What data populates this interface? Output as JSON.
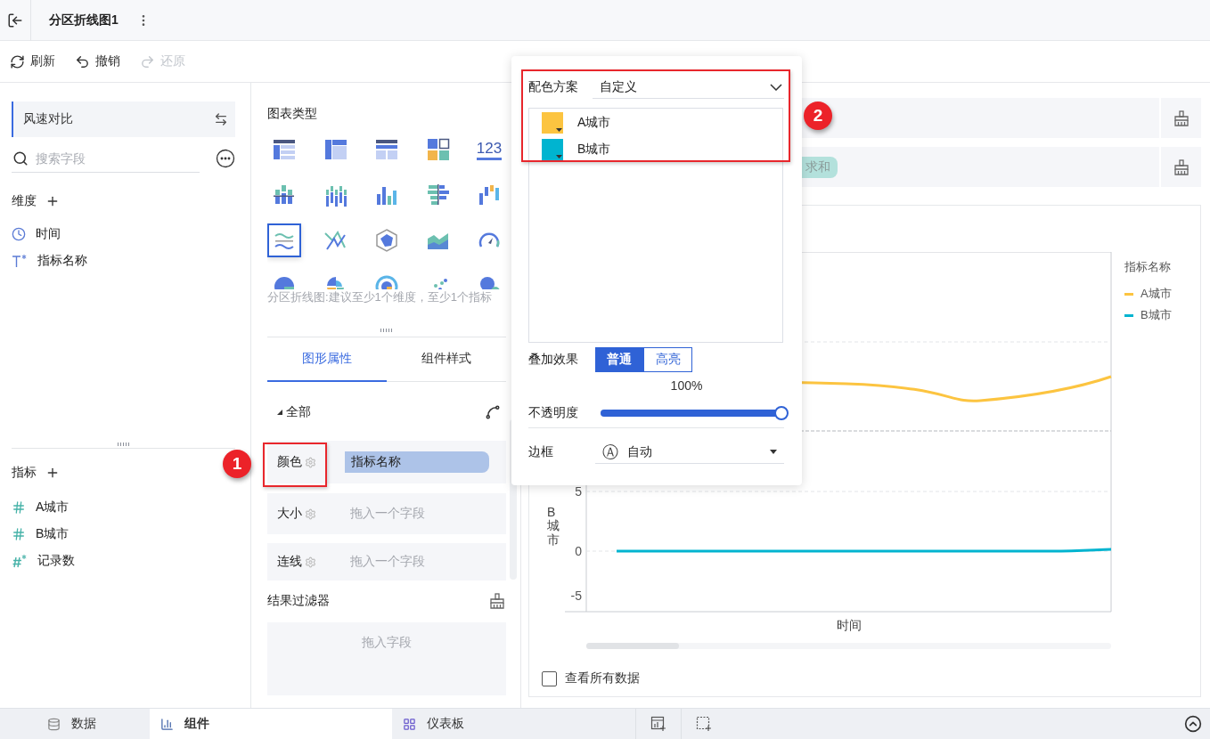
{
  "header": {
    "title": "分区折线图1"
  },
  "toolbar": [
    {
      "label": "刷新",
      "kind": "refresh",
      "disabled": false
    },
    {
      "label": "撤销",
      "kind": "undo",
      "disabled": false
    },
    {
      "label": "还原",
      "kind": "redo",
      "disabled": true
    }
  ],
  "data_panel": {
    "dataset": "风速对比",
    "search": {
      "placeholder": "搜索字段"
    },
    "dimensions": {
      "title": "维度",
      "fields": [
        {
          "name": "时间",
          "kind": "date"
        },
        {
          "name": "指标名称",
          "kind": "text"
        }
      ]
    },
    "measures": {
      "title": "指标",
      "fields": [
        {
          "name": "A城市",
          "kind": "number"
        },
        {
          "name": "B城市",
          "kind": "number"
        },
        {
          "name": "记录数",
          "kind": "count"
        }
      ]
    }
  },
  "chart_types": {
    "title": "图表类型",
    "items": [
      {
        "kind": "table",
        "selected": false
      },
      {
        "kind": "pivot-table",
        "selected": false
      },
      {
        "kind": "group-table",
        "selected": false
      },
      {
        "kind": "tiles",
        "selected": false
      },
      {
        "kind": "number",
        "label": "123",
        "selected": false
      },
      {
        "kind": "stacked-bar",
        "selected": false
      },
      {
        "kind": "grouped-bar",
        "selected": false
      },
      {
        "kind": "bar",
        "selected": false
      },
      {
        "kind": "horizontal-bar",
        "selected": false
      },
      {
        "kind": "waterfall",
        "selected": false
      },
      {
        "kind": "partition-line",
        "selected": true
      },
      {
        "kind": "cross-line",
        "selected": false
      },
      {
        "kind": "radar",
        "selected": false
      },
      {
        "kind": "area",
        "selected": false
      },
      {
        "kind": "gauge",
        "selected": false
      },
      {
        "kind": "pie",
        "selected": false
      },
      {
        "kind": "rose",
        "selected": false
      },
      {
        "kind": "sunburst",
        "selected": false
      },
      {
        "kind": "scatter",
        "selected": false
      },
      {
        "kind": "bubble",
        "selected": false
      }
    ],
    "hint": "分区折线图:建议至少1个维度，至少1个指标"
  },
  "property_tabs": [
    {
      "label": "图形属性",
      "selected": true
    },
    {
      "label": "组件样式",
      "selected": false
    }
  ],
  "properties": {
    "group": "全部",
    "rows": [
      {
        "label": "颜色",
        "value": "指标名称"
      },
      {
        "label": "大小",
        "placeholder": "拖入一个字段"
      },
      {
        "label": "连线",
        "placeholder": "拖入一个字段"
      }
    ]
  },
  "result_filter": {
    "title": "结果过滤器",
    "placeholder": "拖入字段"
  },
  "value_shelf": {
    "chip": "求和"
  },
  "chart": {
    "y_label": "B城市",
    "y_ticks": [
      "5",
      "0",
      "-5"
    ],
    "x_label": "时间",
    "legend": {
      "title": "指标名称",
      "items": [
        {
          "name": "A城市",
          "color": "#fcc440"
        },
        {
          "name": "B城市",
          "color": "#00b4d0"
        }
      ]
    },
    "view_all": {
      "label": "查看所有数据",
      "checked": false
    }
  },
  "color_popover": {
    "label": "配色方案",
    "scheme": "自定义",
    "items": [
      {
        "name": "A城市",
        "color": "#fcc440"
      },
      {
        "name": "B城市",
        "color": "#00b4d0"
      }
    ],
    "blend": {
      "label": "叠加效果",
      "options": [
        {
          "label": "普通",
          "selected": true
        },
        {
          "label": "高亮",
          "selected": false
        }
      ]
    },
    "opacity": {
      "label": "不透明度",
      "reading": "100%",
      "level": 1
    },
    "border": {
      "label": "边框",
      "icon": "Ⓐ",
      "value": "自动"
    }
  },
  "annotations": [
    {
      "label": "1"
    },
    {
      "label": "2"
    }
  ],
  "bottom_tabs": [
    {
      "label": "数据",
      "kind": "data",
      "selected": false
    },
    {
      "label": "组件",
      "kind": "widget",
      "selected": true
    },
    {
      "label": "仪表板",
      "kind": "dashboard",
      "selected": false
    }
  ]
}
